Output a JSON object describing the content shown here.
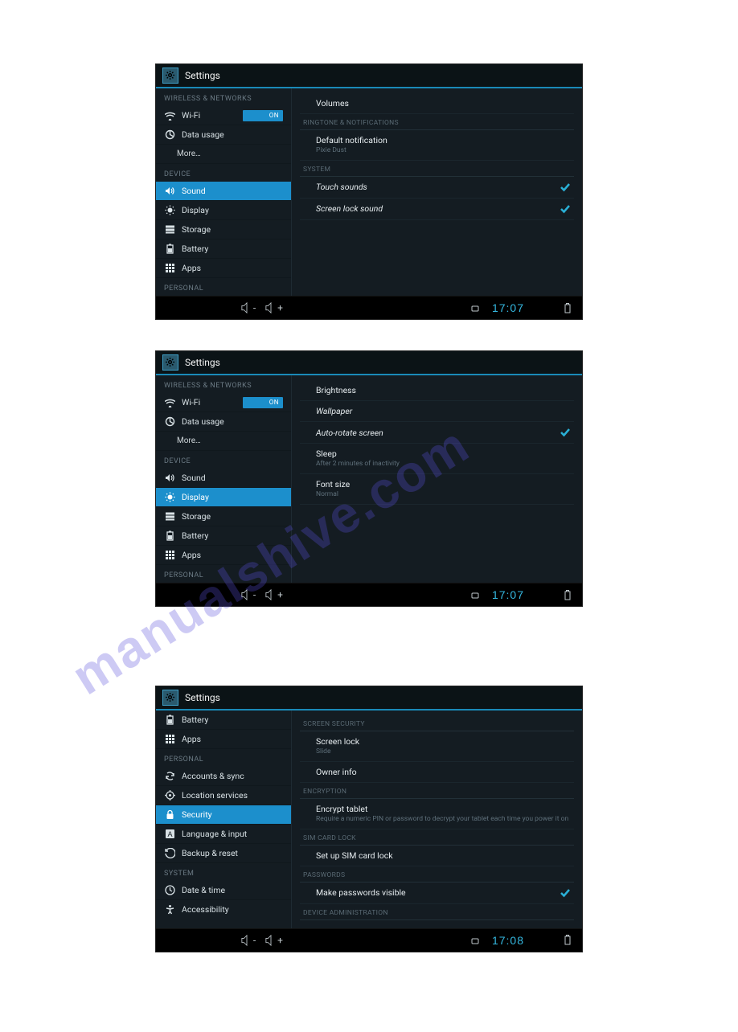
{
  "watermark": "manualshive.com",
  "screens": [
    {
      "title": "Settings",
      "sidebar": [
        {
          "type": "header",
          "label": "WIRELESS & NETWORKS"
        },
        {
          "type": "item",
          "icon": "wifi",
          "label": "Wi-Fi",
          "toggle": "ON"
        },
        {
          "type": "item",
          "icon": "data",
          "label": "Data usage"
        },
        {
          "type": "item",
          "indent": true,
          "label": "More…"
        },
        {
          "type": "header",
          "label": "DEVICE"
        },
        {
          "type": "item",
          "icon": "sound",
          "label": "Sound",
          "selected": true
        },
        {
          "type": "item",
          "icon": "display",
          "label": "Display"
        },
        {
          "type": "item",
          "icon": "storage",
          "label": "Storage"
        },
        {
          "type": "item",
          "icon": "battery",
          "label": "Battery"
        },
        {
          "type": "item",
          "icon": "apps",
          "label": "Apps"
        },
        {
          "type": "header",
          "label": "PERSONAL"
        }
      ],
      "content": [
        {
          "type": "item",
          "title": "Volumes"
        },
        {
          "type": "section",
          "label": "RINGTONE & NOTIFICATIONS"
        },
        {
          "type": "item",
          "title": "Default notification",
          "sub": "Pixie Dust"
        },
        {
          "type": "section",
          "label": "SYSTEM"
        },
        {
          "type": "item",
          "title": "Touch sounds",
          "checked": true,
          "italic": true
        },
        {
          "type": "item",
          "title": "Screen lock sound",
          "checked": true,
          "italic": true
        }
      ],
      "clock": "17:07"
    },
    {
      "title": "Settings",
      "sidebar": [
        {
          "type": "header",
          "label": "WIRELESS & NETWORKS"
        },
        {
          "type": "item",
          "icon": "wifi",
          "label": "Wi-Fi",
          "toggle": "ON"
        },
        {
          "type": "item",
          "icon": "data",
          "label": "Data usage"
        },
        {
          "type": "item",
          "indent": true,
          "label": "More…"
        },
        {
          "type": "header",
          "label": "DEVICE"
        },
        {
          "type": "item",
          "icon": "sound",
          "label": "Sound"
        },
        {
          "type": "item",
          "icon": "display",
          "label": "Display",
          "selected": true
        },
        {
          "type": "item",
          "icon": "storage",
          "label": "Storage"
        },
        {
          "type": "item",
          "icon": "battery",
          "label": "Battery"
        },
        {
          "type": "item",
          "icon": "apps",
          "label": "Apps"
        },
        {
          "type": "header",
          "label": "PERSONAL"
        }
      ],
      "content": [
        {
          "type": "item",
          "title": "Brightness"
        },
        {
          "type": "item",
          "title": "Wallpaper",
          "italic": true
        },
        {
          "type": "item",
          "title": "Auto-rotate screen",
          "checked": true,
          "italic": true
        },
        {
          "type": "item",
          "title": "Sleep",
          "sub": "After 2 minutes of inactivity"
        },
        {
          "type": "item",
          "title": "Font size",
          "sub": "Normal"
        }
      ],
      "clock": "17:07"
    },
    {
      "title": "Settings",
      "sidebar": [
        {
          "type": "item",
          "icon": "battery",
          "label": "Battery"
        },
        {
          "type": "item",
          "icon": "apps",
          "label": "Apps"
        },
        {
          "type": "header",
          "label": "PERSONAL"
        },
        {
          "type": "item",
          "icon": "sync",
          "label": "Accounts & sync"
        },
        {
          "type": "item",
          "icon": "location",
          "label": "Location services"
        },
        {
          "type": "item",
          "icon": "security",
          "label": "Security",
          "selected": true
        },
        {
          "type": "item",
          "icon": "language",
          "label": "Language & input"
        },
        {
          "type": "item",
          "icon": "backup",
          "label": "Backup & reset"
        },
        {
          "type": "header",
          "label": "SYSTEM"
        },
        {
          "type": "item",
          "icon": "datetime",
          "label": "Date & time"
        },
        {
          "type": "item",
          "icon": "accessibility",
          "label": "Accessibility"
        }
      ],
      "content": [
        {
          "type": "section",
          "label": "SCREEN SECURITY"
        },
        {
          "type": "item",
          "title": "Screen lock",
          "sub": "Slide"
        },
        {
          "type": "item",
          "title": "Owner info"
        },
        {
          "type": "section",
          "label": "ENCRYPTION"
        },
        {
          "type": "item",
          "title": "Encrypt tablet",
          "sub": "Require a numeric PIN or password to decrypt your tablet each time you power it on"
        },
        {
          "type": "section",
          "label": "SIM CARD LOCK"
        },
        {
          "type": "item",
          "title": "Set up SIM card lock"
        },
        {
          "type": "section",
          "label": "PASSWORDS"
        },
        {
          "type": "item",
          "title": "Make passwords visible",
          "checked": true
        },
        {
          "type": "section",
          "label": "DEVICE ADMINISTRATION"
        }
      ],
      "clock": "17:08"
    }
  ],
  "icon_names": {
    "wifi": "wifi-icon",
    "data": "data-usage-icon",
    "sound": "speaker-icon",
    "display": "display-icon",
    "storage": "storage-icon",
    "battery": "battery-icon",
    "apps": "apps-icon",
    "sync": "sync-icon",
    "location": "location-icon",
    "security": "lock-icon",
    "language": "language-icon",
    "backup": "backup-icon",
    "datetime": "clock-icon",
    "accessibility": "accessibility-icon"
  }
}
